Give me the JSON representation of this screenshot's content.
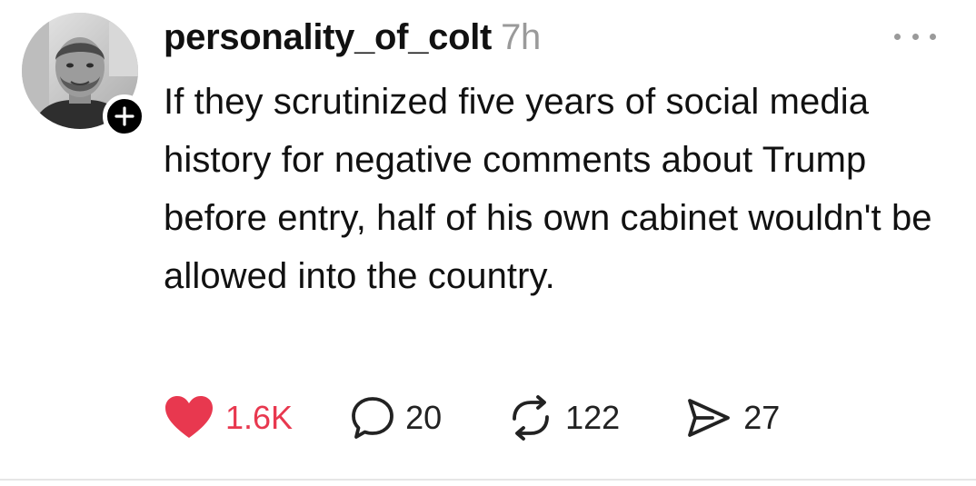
{
  "post": {
    "username": "personality_of_colt",
    "time": "7h",
    "text": "If they scrutinized five years of social media history for negative comments about Trump before entry, half of his own cabinet wouldn't be allowed into the country.",
    "stats": {
      "likes": "1.6K",
      "comments": "20",
      "reposts": "122",
      "shares": "27"
    }
  },
  "icons": {
    "avatar": "avatar",
    "follow": "plus-icon",
    "more": "ellipsis-icon",
    "like": "heart-icon",
    "comment": "comment-bubble-icon",
    "repost": "repost-icon",
    "share": "send-icon"
  },
  "colors": {
    "like_accent": "#e8384f",
    "timestamp": "#9a9a9a",
    "text": "#111111"
  }
}
